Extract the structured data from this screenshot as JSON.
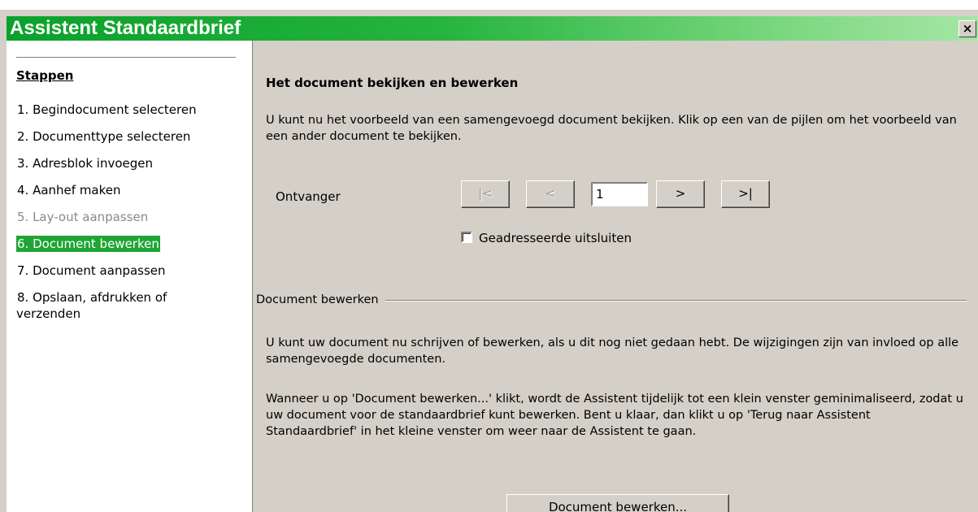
{
  "window": {
    "title": "Assistent Standaardbrief",
    "close_label": "×"
  },
  "sidebar": {
    "title": "Stappen",
    "steps": [
      {
        "label": "1. Begindocument selecteren",
        "state": "normal"
      },
      {
        "label": "2. Documenttype selecteren",
        "state": "normal"
      },
      {
        "label": "3. Adresblok invoegen",
        "state": "normal"
      },
      {
        "label": "4. Aanhef maken",
        "state": "normal"
      },
      {
        "label": "5. Lay-out aanpassen",
        "state": "disabled"
      },
      {
        "label": "6. Document bewerken",
        "state": "active"
      },
      {
        "label": "7. Document aanpassen",
        "state": "normal"
      },
      {
        "label": "8. Opslaan, afdrukken of verzenden",
        "state": "normal"
      }
    ]
  },
  "main": {
    "heading": "Het document bekijken en bewerken",
    "intro": "U kunt nu het voorbeeld van een samengevoegd document bekijken. Klik op een van de pijlen om het voorbeeld van een ander document te bekijken.",
    "recipient_label": "Ontvanger",
    "nav": {
      "first": "|<",
      "prev": "<",
      "current": "1",
      "next": ">",
      "last": ">|"
    },
    "exclude_checkbox": {
      "label": "Geadresseerde uitsluiten",
      "checked": false
    },
    "group_label": "Document bewerken",
    "paragraph1": "U kunt uw document nu schrijven of bewerken, als u dit nog niet gedaan hebt. De wijzigingen zijn van invloed op alle samengevoegde documenten.",
    "paragraph2": "Wanneer u op 'Document bewerken...' klikt, wordt de Assistent tijdelijk tot een klein venster geminimaliseerd, zodat u uw document voor de standaardbrief kunt bewerken. Bent u klaar, dan klikt u op 'Terug naar Assistent Standaardbrief' in het kleine venster om weer naar de Assistent te gaan.",
    "edit_button": "Document bewerken..."
  },
  "colors": {
    "titlebar_start": "#0aa12a",
    "titlebar_end": "#a6e6a6",
    "active_step": "#1fa535",
    "dialog_bg": "#d4d0c8"
  }
}
